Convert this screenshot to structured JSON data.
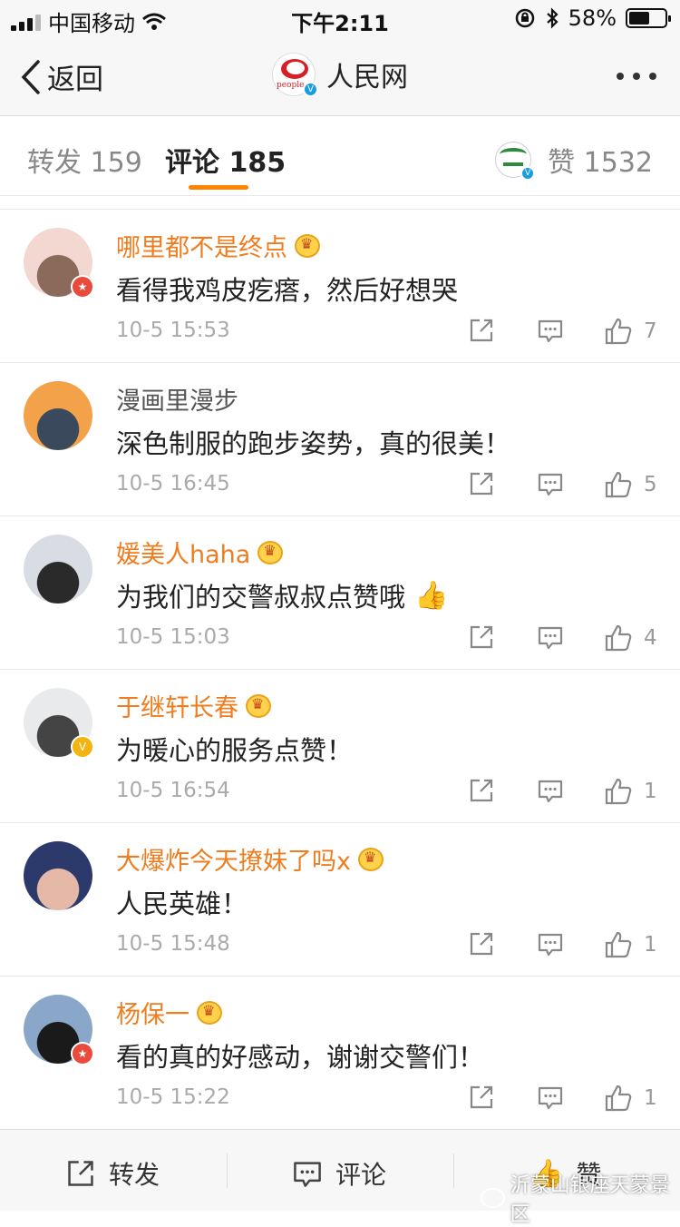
{
  "status_bar": {
    "carrier": "中国移动",
    "time": "下午2:11",
    "battery": "58%",
    "battery_level": 0.58
  },
  "nav": {
    "back_label": "返回",
    "title": "人民网",
    "logo_text": "people."
  },
  "tabs": {
    "repost": "转发 159",
    "comments": "评论 185",
    "likes": "赞 1532"
  },
  "comments": [
    {
      "user": "哪里都不是终点",
      "vip": true,
      "badge": "red",
      "text": "看得我鸡皮疙瘩，然后好想哭",
      "time": "10-5 15:53",
      "likes": "7",
      "avatar_colors": [
        "#f2d8d0",
        "#8b6a5c"
      ]
    },
    {
      "user": "漫画里漫步",
      "vip": false,
      "badge": "",
      "text": "深色制服的跑步姿势，真的很美！",
      "time": "10-5 16:45",
      "likes": "5",
      "avatar_colors": [
        "#f4a24a",
        "#3a4a5c"
      ]
    },
    {
      "user": "媛美人haha",
      "vip": true,
      "badge": "",
      "text": "为我们的交警叔叔点赞哦",
      "time": "10-5 15:03",
      "likes": "4",
      "avatar_colors": [
        "#d9dde3",
        "#2a2a2a"
      ],
      "emoji": "👍"
    },
    {
      "user": "于继轩长春",
      "vip": true,
      "badge": "gold",
      "text": "为暖心的服务点赞！",
      "time": "10-5 16:54",
      "likes": "1",
      "avatar_colors": [
        "#e9eaec",
        "#444"
      ]
    },
    {
      "user": "大爆炸今天撩妹了吗x",
      "vip": true,
      "badge": "",
      "text": "人民英雄！",
      "time": "10-5 15:48",
      "likes": "1",
      "avatar_colors": [
        "#2b3a6a",
        "#e6b8a8"
      ]
    },
    {
      "user": "杨保一",
      "vip": true,
      "badge": "red",
      "text": "看的真的好感动，谢谢交警们！",
      "time": "10-5 15:22",
      "likes": "1",
      "avatar_colors": [
        "#8aa6c8",
        "#1a1a1a"
      ]
    }
  ],
  "bottom_bar": {
    "repost": "转发",
    "comment": "评论",
    "like": "赞"
  },
  "watermark": "沂蒙山银座天蒙景区",
  "colors": {
    "accent_orange": "#ff8200",
    "vip_name": "#ef7d1f",
    "verified_blue": "#1a9ce4"
  }
}
